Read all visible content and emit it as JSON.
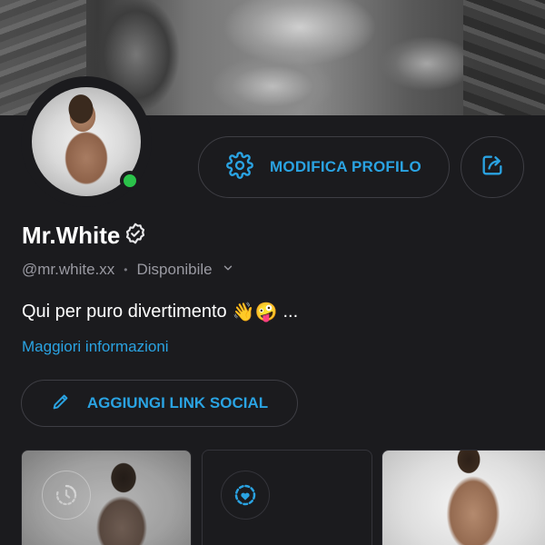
{
  "profile": {
    "name": "Mr.White",
    "handle": "@mr.white.xx",
    "status": "Disponibile",
    "bio_text": "Qui per puro divertimento",
    "bio_emojis": "👋🤪",
    "bio_ellipsis": "...",
    "more_info": "Maggiori informazioni",
    "online": true
  },
  "actions": {
    "edit_profile": "MODIFICA PROFILO",
    "add_social_links": "AGGIUNGI LINK SOCIAL"
  },
  "colors": {
    "accent": "#2aa3e2",
    "online": "#2bc24a",
    "background": "#1b1b1e"
  },
  "media_tiles": [
    {
      "type": "photo",
      "badge_icon": "timer-icon"
    },
    {
      "type": "empty",
      "badge_icon": "heart-clock-icon"
    },
    {
      "type": "photo",
      "badge_icon": ""
    }
  ]
}
